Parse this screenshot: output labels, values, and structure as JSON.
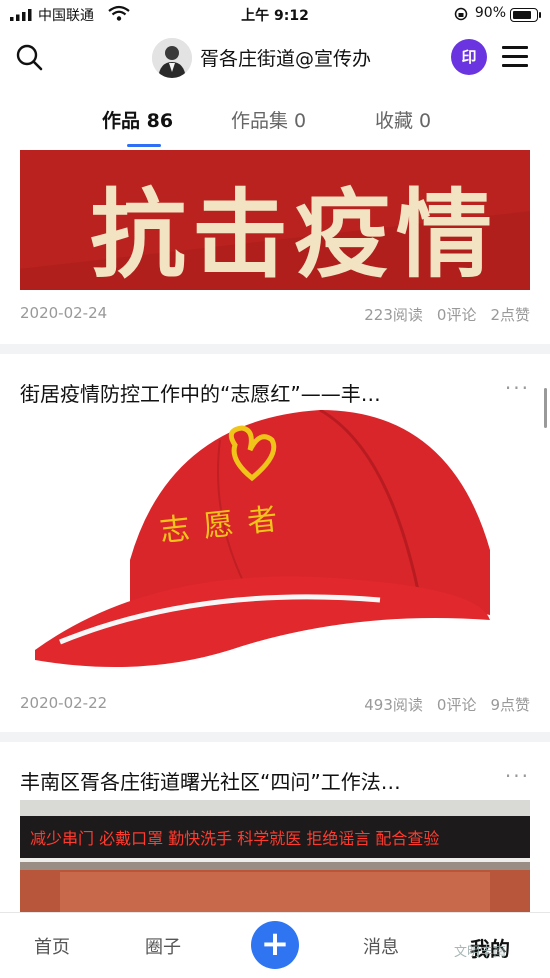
{
  "status_bar": {
    "carrier": "中国联通",
    "time": "上午 9:12",
    "battery": "90%",
    "battery_level": 0.9
  },
  "header": {
    "title": "胥各庄街道@宣传办",
    "badge": "印"
  },
  "tabs": [
    {
      "label": "作品 86",
      "active": true
    },
    {
      "label": "作品集 0",
      "active": false
    },
    {
      "label": "收藏 0",
      "active": false
    }
  ],
  "posts": [
    {
      "banner_text": "抗击疫情",
      "date": "2020-02-24",
      "reads": "223阅读",
      "comments": "0评论",
      "likes": "2点赞"
    },
    {
      "title": "街居疫情防控工作中的“志愿红”——丰…",
      "more": "···",
      "cap_text": "志愿者",
      "date": "2020-02-22",
      "reads": "493阅读",
      "comments": "0评论",
      "likes": "9点赞"
    },
    {
      "title": "丰南区胥各庄街道曙光社区“四问”工作法…",
      "more": "···",
      "sign_text": "减少串门 必戴口罩 勤快洗手 科学就医 拒绝谣言 配合查验"
    }
  ],
  "bottom_nav": {
    "home": "首页",
    "circle": "圈子",
    "plus": "+",
    "messages": "消息",
    "mine": "我的",
    "watermark": "文明丰南"
  },
  "colors": {
    "accent_blue": "#2f75f2",
    "badge_purple": "#6a35e0",
    "banner_red": "#b9221f",
    "cap_red": "#d9262b",
    "cap_gold": "#f0c419"
  }
}
